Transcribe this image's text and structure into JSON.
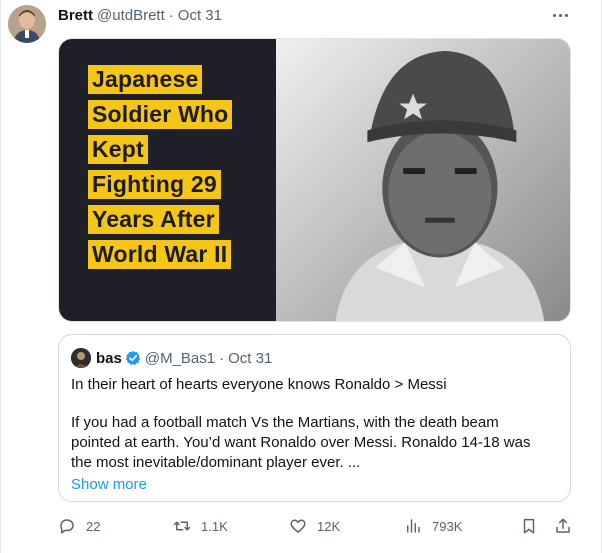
{
  "tweet": {
    "author_name": "Brett",
    "author_handle": "@utdBrett",
    "separator": "·",
    "date": "Oct 31",
    "more_icon": "more-horizontal-icon",
    "media": {
      "headline_lines": [
        "Japanese",
        "Soldier Who",
        "Kept",
        "Fighting 29",
        "Years After",
        "World War II"
      ],
      "highlight_color": "#f5c518",
      "panel_color": "#1f2027"
    }
  },
  "quote": {
    "author_name": "bas",
    "verified_icon": "verified-badge-icon",
    "author_handle": "@M_Bas1",
    "separator": "·",
    "date": "Oct 31",
    "line1": "In their heart of hearts everyone knows Ronaldo > Messi",
    "paragraph": "If you had a football match Vs the Martians, with the death beam pointed at earth. You’d want Ronaldo over Messi. Ronaldo 14-18 was the most inevitable/dominant player ever. ...",
    "show_more": "Show more"
  },
  "actions": {
    "replies": "22",
    "reposts": "1.1K",
    "likes": "12K",
    "views": "793K",
    "reply_icon": "reply-icon",
    "repost_icon": "repost-icon",
    "like_icon": "heart-icon",
    "views_icon": "views-chart-icon",
    "bookmark_icon": "bookmark-icon",
    "share_icon": "share-icon"
  },
  "colors": {
    "accent": "#1d9bf0",
    "secondary_text": "#536471"
  }
}
